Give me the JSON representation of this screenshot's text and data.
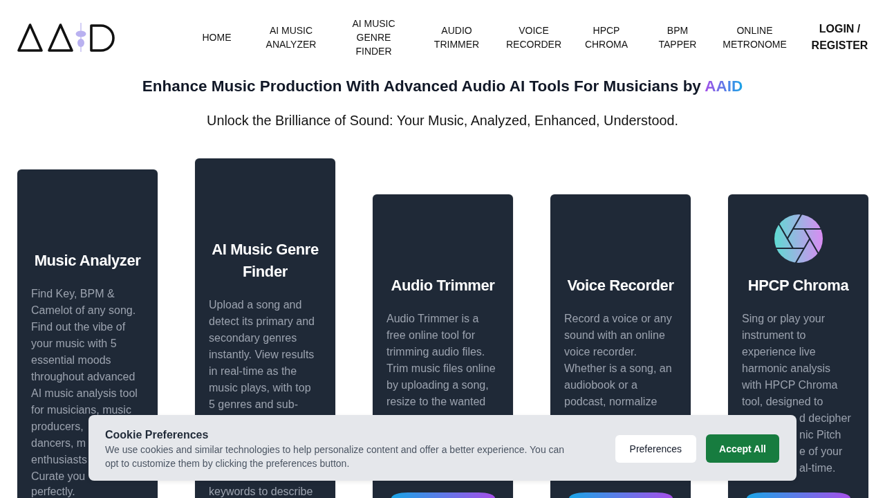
{
  "header": {
    "nav": [
      "HOME",
      "AI MUSIC ANALYZER",
      "AI MUSIC GENRE FINDER",
      "AUDIO TRIMMER",
      "VOICE RECORDER",
      "HPCP CHROMA",
      "BPM TAPPER",
      "ONLINE METRONOME"
    ],
    "account_link": "LOGIN / REGISTER"
  },
  "hero": {
    "headline": "Enhance Music Production With Advanced Audio AI Tools For Musicians by",
    "headline_highlight": "AAID",
    "subtitle": "Unlock the Brilliance of Sound: Your Music, Analyzed, Enhanced, Understood."
  },
  "cards": [
    {
      "title": "Music Analyzer",
      "show_icon": false,
      "text": "Find Key, BPM &\nCamelot of any song.\nFind out the vibe of\nyour music with 5\nessential moods\nthroughout advanced\nAI music analysis tool\nfor musicians, music",
      "beside_banner": {
        "covered_left": false,
        "text": "producers,\ndancers, m\nenthusiasts\nCurate you"
      },
      "text_below_banner": "perfectly.",
      "has_button": false
    },
    {
      "title": "AI Music Genre Finder",
      "show_icon": false,
      "text": "Upload a song and\ndetect its primary and\nsecondary genres\ninstantly. View results\nin real-time as the\nmusic plays, with top\n5 genres and sub-",
      "text_below_banner": "keywords to describe",
      "has_button": false
    },
    {
      "title": "Audio Trimmer",
      "show_icon": false,
      "text": "Audio Trimmer is a\nfree online tool for\ntrimming audio files.\nTrim music files online\nby uploading a song,\nresize to the wanted",
      "has_button": true
    },
    {
      "title": "Voice Recorder",
      "show_icon": false,
      "text": "Record a voice or any\nsound with an online\nvoice recorder.\nWhether is a song, an\naudiobook or a\npodcast, normalize",
      "has_button": true
    },
    {
      "title": "HPCP Chroma",
      "show_icon": true,
      "text": "Sing or play your\ninstrument to\nexperience live\nharmonic analysis\nwith HPCP Chroma\ntool, designed to",
      "beside_banner": {
        "covered_left": true,
        "text": "d decipher\nnic Pitch\ne of your\nal-time."
      },
      "has_button": true
    }
  ],
  "cookie_banner": {
    "title": "Cookie Preferences",
    "text": "We use cookies and similar technologies to help personalize content and offer a better experience. You can opt to customize them by clicking the preferences button.",
    "buttons": [
      {
        "label": "Preferences",
        "kind": "secondary"
      },
      {
        "label": "Accept All",
        "kind": "primary"
      }
    ]
  }
}
